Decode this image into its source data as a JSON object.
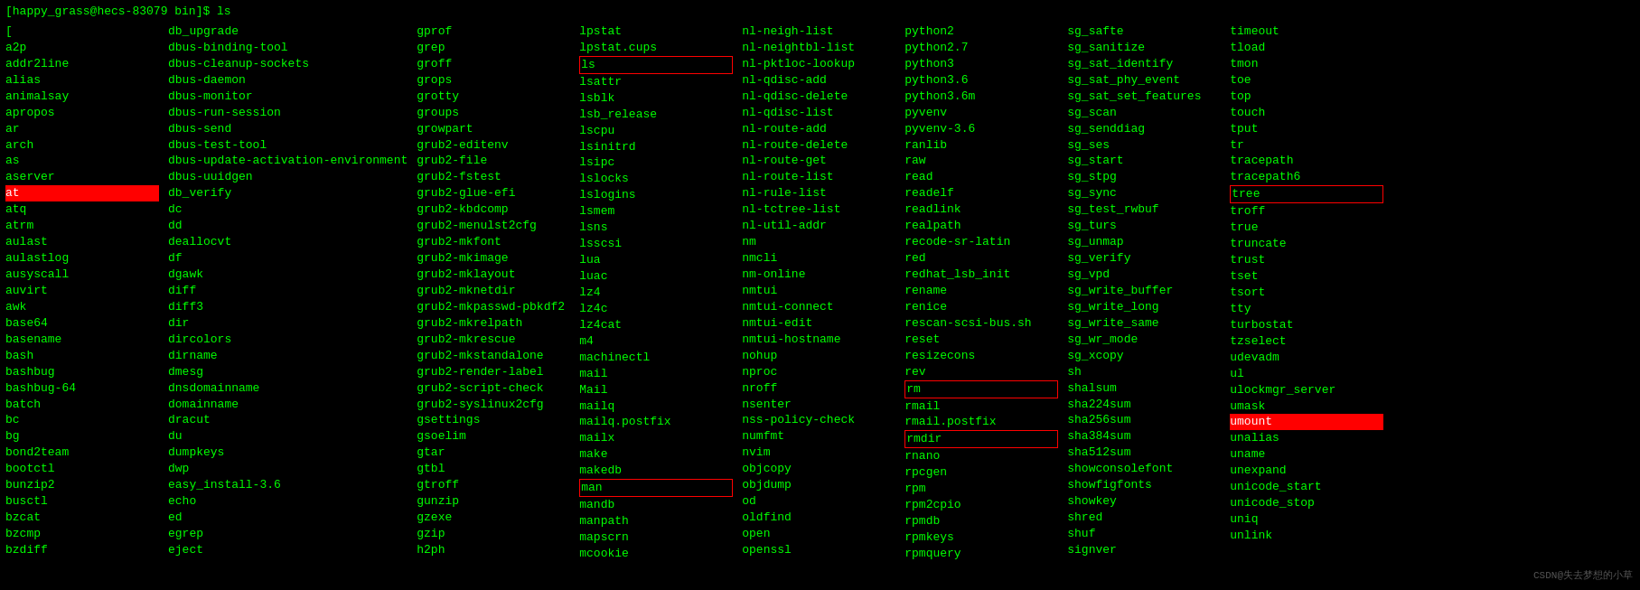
{
  "prompt": "[happy_grass@hecs-83079 bin]$ ls",
  "columns": [
    [
      "[",
      "a2p",
      "addr2line",
      "alias",
      "animalsay",
      "apropos",
      "ar",
      "arch",
      "as",
      "aserver",
      "at",
      "atq",
      "atrm",
      "aulast",
      "aulastlog",
      "ausyscall",
      "auvirt",
      "awk",
      "base64",
      "basename",
      "bash",
      "bashbug",
      "bashbug-64",
      "batch",
      "bc",
      "bg",
      "bond2team",
      "bootctl",
      "bunzip2",
      "busctl",
      "bzcat",
      "bzcmp",
      "bzdiff"
    ],
    [
      "db_upgrade",
      "dbus-binding-tool",
      "dbus-cleanup-sockets",
      "dbus-daemon",
      "dbus-monitor",
      "dbus-run-session",
      "dbus-send",
      "dbus-test-tool",
      "dbus-update-activation-environment",
      "dbus-uuidgen",
      "db_verify",
      "dc",
      "dd",
      "deallocvt",
      "df",
      "dgawk",
      "diff",
      "diff3",
      "dir",
      "dircolors",
      "dirname",
      "dmesg",
      "dnsdomainname",
      "domainname",
      "dracut",
      "du",
      "dumpkeys",
      "dwp",
      "easy_install-3.6",
      "echo",
      "ed",
      "egrep",
      "eject"
    ],
    [
      "gprof",
      "grep",
      "groff",
      "grops",
      "grotty",
      "groups",
      "growpart",
      "grub2-editenv",
      "grub2-file",
      "grub2-fstest",
      "grub2-glue-efi",
      "grub2-kbdcomp",
      "grub2-menulst2cfg",
      "grub2-mkfont",
      "grub2-mkimage",
      "grub2-mklayout",
      "grub2-mknetdir",
      "grub2-mkpasswd-pbkdf2",
      "grub2-mkrelpath",
      "grub2-mkrescue",
      "grub2-mkstandalone",
      "grub2-render-label",
      "grub2-script-check",
      "grub2-syslinux2cfg",
      "gsettings",
      "gsoelim",
      "gtar",
      "gtbl",
      "gtroff",
      "gunzip",
      "gzexe",
      "gzip",
      "h2ph"
    ],
    [
      "lpstat",
      "lpstat.cups",
      "ls",
      "lsattr",
      "lsblk",
      "lsb_release",
      "lscpu",
      "lsinitrd",
      "lsipc",
      "lslocks",
      "lslogins",
      "lsmem",
      "lsns",
      "lsscsi",
      "lua",
      "luac",
      "lz4",
      "lz4c",
      "lz4cat",
      "m4",
      "machinectl",
      "mail",
      "Mail",
      "mailq",
      "mailq.postfix",
      "mailx",
      "make",
      "makedb",
      "man",
      "mandb",
      "manpath",
      "mapscrn",
      "mcookie"
    ],
    [
      "nl-neigh-list",
      "nl-neightbl-list",
      "nl-pktloc-lookup",
      "nl-qdisc-add",
      "nl-qdisc-delete",
      "nl-qdisc-list",
      "nl-route-add",
      "nl-route-delete",
      "nl-route-get",
      "nl-route-list",
      "nl-rule-list",
      "nl-tctree-list",
      "nl-util-addr",
      "nm",
      "nmcli",
      "nm-online",
      "nmtui",
      "nmtui-connect",
      "nmtui-edit",
      "nmtui-hostname",
      "nohup",
      "nproc",
      "nroff",
      "nsenter",
      "nss-policy-check",
      "numfmt",
      "nvim",
      "objcopy",
      "objdump",
      "od",
      "oldfind",
      "open",
      "openssl"
    ],
    [
      "python2",
      "python2.7",
      "python3",
      "python3.6",
      "python3.6m",
      "pyvenv",
      "pyvenv-3.6",
      "ranlib",
      "raw",
      "read",
      "readelf",
      "readlink",
      "realpath",
      "recode-sr-latin",
      "red",
      "redhat_lsb_init",
      "rename",
      "renice",
      "rescan-scsi-bus.sh",
      "reset",
      "resizecons",
      "rev",
      "rm",
      "rmail",
      "rmail.postfix",
      "rmdir",
      "rnano",
      "rpcgen",
      "rpm",
      "rpm2cpio",
      "rpmdb",
      "rpmkeys",
      "rpmquery"
    ],
    [
      "sg_safte",
      "sg_sanitize",
      "sg_sat_identify",
      "sg_sat_phy_event",
      "sg_sat_set_features",
      "sg_scan",
      "sg_senddiag",
      "sg_ses",
      "sg_start",
      "sg_stpg",
      "sg_sync",
      "sg_test_rwbuf",
      "sg_turs",
      "sg_unmap",
      "sg_verify",
      "sg_vpd",
      "sg_write_buffer",
      "sg_write_long",
      "sg_write_same",
      "sg_wr_mode",
      "sg_xcopy",
      "sh",
      "shalsum",
      "sha224sum",
      "sha256sum",
      "sha384sum",
      "sha512sum",
      "showconsolefont",
      "showfigfonts",
      "showkey",
      "shred",
      "shuf",
      "signver"
    ],
    [
      "timeout",
      "tload",
      "tmon",
      "toe",
      "top",
      "touch",
      "tput",
      "tr",
      "tracepath",
      "tracepath6",
      "tree",
      "troff",
      "true",
      "truncate",
      "trust",
      "tset",
      "tsort",
      "tty",
      "turbostat",
      "tzselect",
      "udevadm",
      "ul",
      "ulockmgr_server",
      "umask",
      "umount",
      "unalias",
      "uname",
      "unexpand",
      "unicode_start",
      "unicode_stop",
      "uniq",
      "unlink"
    ]
  ],
  "highlighted_items": [
    "at",
    "umount"
  ],
  "boxed_items": [
    "ls",
    "man",
    "rm",
    "rmdir",
    "tree"
  ],
  "watermark": "CSDN@失去梦想的小草"
}
